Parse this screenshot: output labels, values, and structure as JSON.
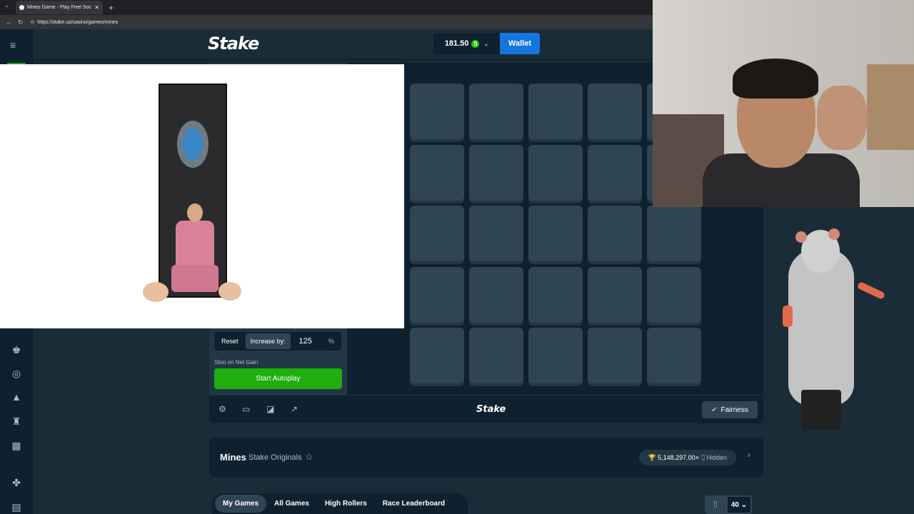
{
  "browser": {
    "tab_title": "Mines Game - Play Free Social Ca...",
    "tab_close": "✕",
    "new_tab": "+",
    "url": "https://stake.us/casino/games/mines"
  },
  "header": {
    "logo": "Stake",
    "balance": "181.50",
    "currency_symbol": "S",
    "wallet_label": "Wallet"
  },
  "autobet": {
    "reset_label": "Reset",
    "increase_label": "Increase by:",
    "increase_value": "125",
    "percent_symbol": "%",
    "stop_on_net_gain_label": "Stop on Net Gain",
    "start_autoplay_label": "Start Autoplay"
  },
  "footer": {
    "logo": "Stake",
    "fairness_label": "Fairness"
  },
  "game_info": {
    "name": "Mines",
    "provider": "Stake Originals",
    "jackpot_multiplier": "5,148,297.00×",
    "jackpot_user": "Hidden"
  },
  "bets_tabs": {
    "tabs": [
      "My Games",
      "All Games",
      "High Rollers",
      "Race Leaderboard"
    ],
    "active": "My Games",
    "rows_count": "40"
  },
  "grid": {
    "rows": 5,
    "cols": 5
  },
  "colors": {
    "bg": "#1a2c38",
    "tile": "#2f4553",
    "accent_blue": "#1475e1",
    "accent_green": "#1fae0c"
  }
}
